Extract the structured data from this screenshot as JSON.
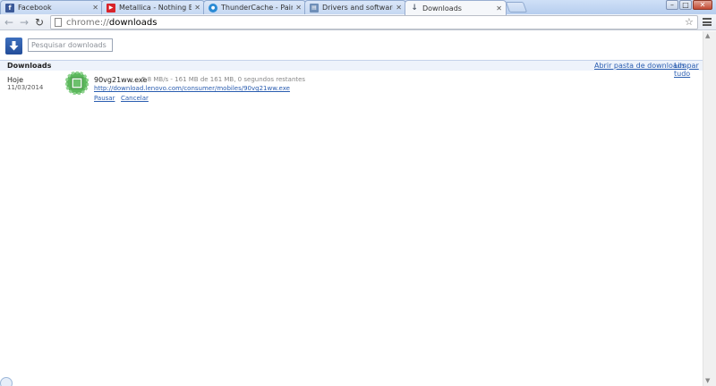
{
  "tabs": [
    {
      "title": "Facebook",
      "icon": "facebook-icon",
      "glyph": "f",
      "color": "#3b5998",
      "close": "✕",
      "active": false
    },
    {
      "title": "Metallica - Nothing Else M",
      "icon": "youtube-icon",
      "glyph": "▶",
      "color": "#d8232a",
      "close": "✕",
      "active": false
    },
    {
      "title": "ThunderCache - Painel de",
      "icon": "thundercache-icon",
      "glyph": "●",
      "color": "#2a8ad4",
      "close": "✕",
      "active": false
    },
    {
      "title": "Drivers and software - Len",
      "icon": "lenovo-page-icon",
      "glyph": "▤",
      "color": "#6f8fb8",
      "close": "✕",
      "active": false
    },
    {
      "title": "Downloads",
      "icon": "downloads-tab-icon",
      "glyph": "↓",
      "color": "#6a7688",
      "close": "✕",
      "active": true
    }
  ],
  "window_controls": {
    "minimize": "–",
    "maximize": "□",
    "close": "✕"
  },
  "toolbar": {
    "back": "←",
    "forward": "→",
    "reload": "↻",
    "url_scheme": "chrome://",
    "url_host": "downloads",
    "star": "☆"
  },
  "search": {
    "placeholder": "Pesquisar downloads",
    "value": ""
  },
  "section": {
    "title": "Downloads",
    "open_folder": "Abrir pasta de downloads",
    "clear_all": "Limpar tudo"
  },
  "downloads": [
    {
      "date_label": "Hoje",
      "date": "11/03/2014",
      "file_name": "90vg21ww.exe",
      "status": "5,8 MB/s - 161 MB de 161 MB, 0 segundos restantes",
      "url": "http://download.lenovo.com/consumer/mobiles/90vg21ww.exe",
      "pause": "Pausar",
      "cancel": "Cancelar",
      "progress": 1.0
    }
  ],
  "scrollbar": {
    "up": "▲",
    "down": "▼"
  },
  "colors": {
    "link": "#2a5db0",
    "progress": "#5cb85c",
    "logo": "#2f5ea8"
  }
}
